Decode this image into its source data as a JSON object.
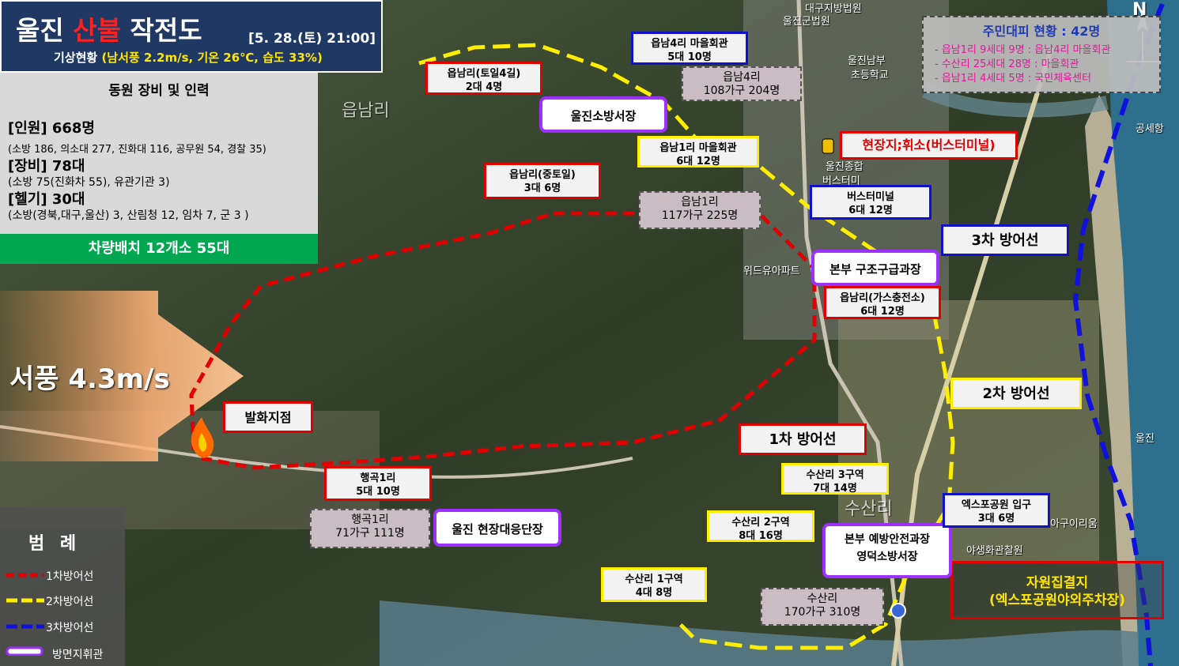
{
  "title": {
    "prefix": "울진",
    "highlight": "산불",
    "suffix": "작전도",
    "datetime": "[5. 28.(토) 21:00]"
  },
  "weather": {
    "label": "기상현황",
    "values": "(남서풍 2.2m/s, 기온 26℃, 습도 33%)"
  },
  "resources": {
    "title": "동원 장비 및 인력",
    "personnel": "[인원] 668명",
    "personnel_detail": "(소방 186, 의소대 277, 진화대 116, 공무원 54, 경찰 35)",
    "equipment": "[장비] 78대",
    "equipment_detail": "(소방 75(진화차 55), 유관기관 3)",
    "helicopters": "[헬기] 30대",
    "helicopters_detail": "(소방(경북,대구,울산) 3, 산림청 12, 임차 7, 군 3 )"
  },
  "vehicle_deploy": "차량배치 12개소 55대",
  "evacuation": {
    "title": "주민대피 현황 : 42명",
    "lines": [
      "- 읍남1리 9세대 9명 : 읍남4리 마을회관",
      "- 수산리  25세대 28명 : 마을회관",
      "- 읍남1리 4세대 5명 : 국민체육센터"
    ]
  },
  "wind": "서풍 4.3m/s",
  "ignition": "발화지점",
  "hq_rest": "현장지;휘소(버스터미널)",
  "staging": {
    "line1": "자원집결지",
    "line2": "(엑스포공원야외주차장)"
  },
  "defense_lines": {
    "first": "1차 방어선",
    "second": "2차 방어선",
    "third": "3차 방어선"
  },
  "callouts": {
    "c1": {
      "l1": "읍남4리 마을회관",
      "l2": "5대 10명"
    },
    "c2": {
      "l1": "읍남리(토일4길)",
      "l2": "2대 4명"
    },
    "c3": {
      "l1": "읍남4리",
      "l2": "108가구 204명"
    },
    "c4": {
      "l1": "울진소방서장"
    },
    "c5": {
      "l1": "읍남1리 마을회관",
      "l2": "6대 12명"
    },
    "c6": {
      "l1": "읍남리(중토일)",
      "l2": "3대 6명"
    },
    "c7": {
      "l1": "읍남1리",
      "l2": "117가구 225명"
    },
    "c8": {
      "l1": "버스터미널",
      "l2": "6대 12명"
    },
    "c9": {
      "l1": "본부 구조구급과장"
    },
    "c10": {
      "l1": "읍남리(가스충전소)",
      "l2": "6대 12명"
    },
    "c11": {
      "l1": "행곡1리",
      "l2": "5대 10명"
    },
    "c12": {
      "l1": "행곡1리",
      "l2": "71가구 111명"
    },
    "c13": {
      "l1": "울진 현장대응단장"
    },
    "c14": {
      "l1": "수산리 3구역",
      "l2": "7대 14명"
    },
    "c15": {
      "l1": "수산리 2구역",
      "l2": "8대 16명"
    },
    "c16": {
      "l1": "본부 예방안전과장",
      "l2": "영덕소방서장"
    },
    "c17": {
      "l1": "엑스포공원 입구",
      "l2": "3대 6명"
    },
    "c18": {
      "l1": "수산리 1구역",
      "l2": "4대 8명"
    },
    "c19": {
      "l1": "수산리",
      "l2": "170가구 310명"
    }
  },
  "legend": {
    "title": "범 례",
    "items": [
      "1차방어선",
      "2차방어선",
      "3차방어선",
      "방면지휘관"
    ]
  },
  "map_labels": {
    "court": "대구지방법원",
    "court2": "울진군법원",
    "school": "울진남부",
    "school2": "초등학교",
    "eupnam": "읍남리",
    "susan": "수산리",
    "gongse": "공세항",
    "uljin": "울진",
    "north": "N",
    "ulsan_school": "울진종합",
    "bus": "버스터미",
    "widu": "위드유아파트",
    "yasaeng": "야생화관찰원",
    "agu": "아구이리움"
  },
  "colors": {
    "first_line": "#e00000",
    "second_line": "#ffee00",
    "third_line": "#1111cc",
    "commander": "#9b30ff",
    "title_bg": "#1f3864",
    "vehicle_bg": "#00a650"
  }
}
